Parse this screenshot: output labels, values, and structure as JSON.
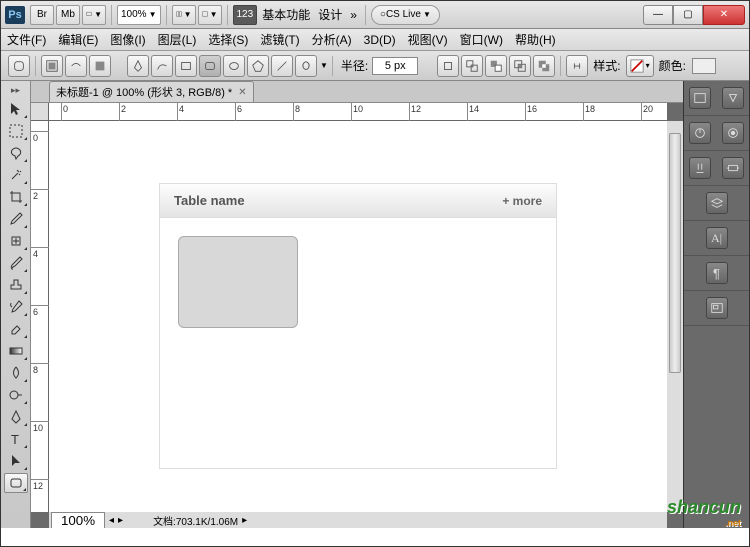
{
  "title": {
    "zoom": "100%",
    "num": "123",
    "ws1": "基本功能",
    "ws2": "设计",
    "cslive": "CS Live"
  },
  "menu": {
    "file": "文件(F)",
    "edit": "编辑(E)",
    "image": "图像(I)",
    "layer": "图层(L)",
    "select": "选择(S)",
    "filter": "滤镜(T)",
    "analysis": "分析(A)",
    "threed": "3D(D)",
    "view": "视图(V)",
    "window": "窗口(W)",
    "help": "帮助(H)"
  },
  "opt": {
    "radius_label": "半径:",
    "radius_value": "5 px",
    "style_label": "样式:",
    "color_label": "颜色:"
  },
  "doc": {
    "tab": "未标题-1 @ 100% (形状 3, RGB/8) *",
    "zoom": "100%",
    "info_label": "文档:",
    "info_value": "703.1K/1.06M"
  },
  "canvas": {
    "card_title": "Table name",
    "card_more": "+ more"
  },
  "ruler_h": [
    "0",
    "2",
    "4",
    "6",
    "8",
    "10",
    "12",
    "14",
    "16",
    "18",
    "20"
  ],
  "ruler_v": [
    "0",
    "2",
    "4",
    "6",
    "8",
    "10",
    "12"
  ],
  "watermark": {
    "main": "shancun",
    "sub": ".net"
  }
}
